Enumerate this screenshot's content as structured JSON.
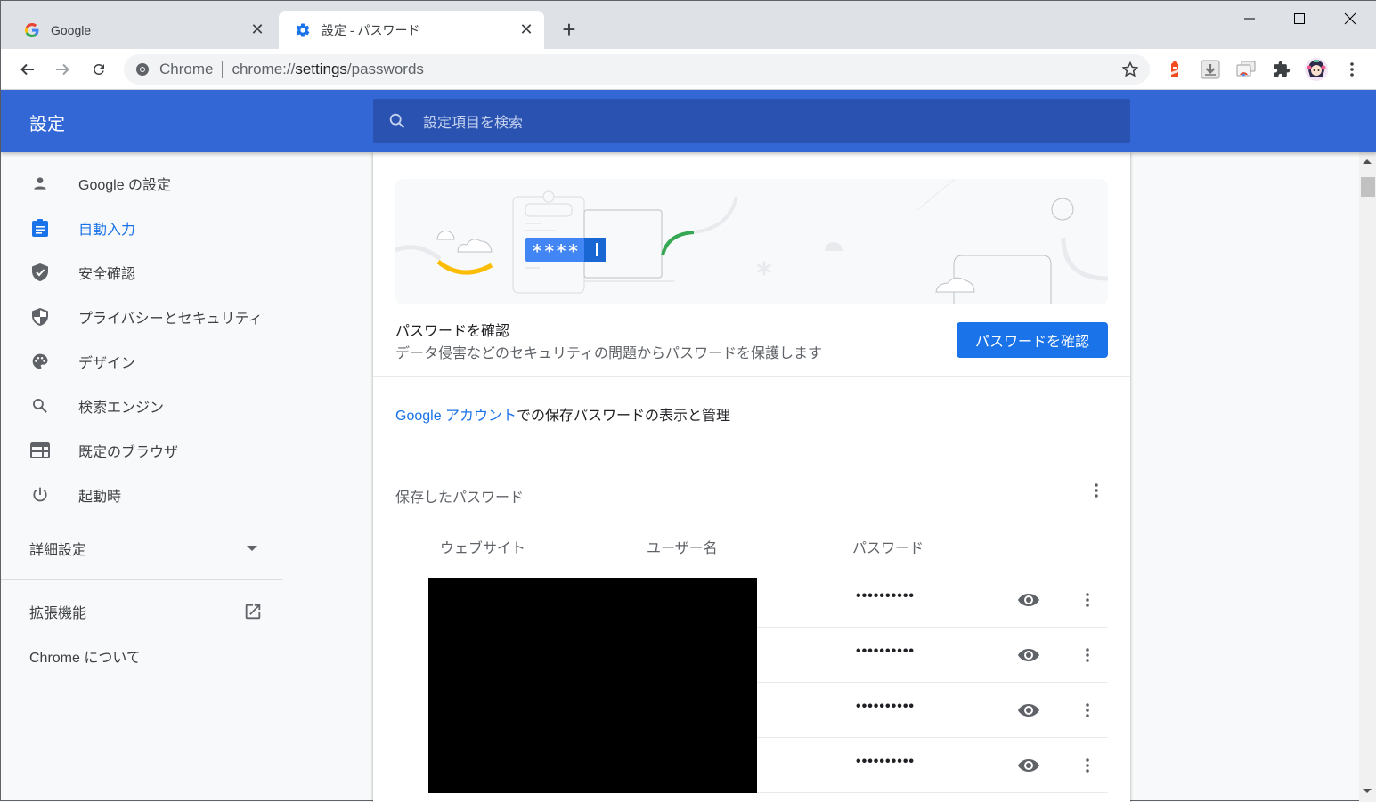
{
  "browser": {
    "tabs": [
      {
        "title": "Google",
        "favicon": "google-g-icon",
        "active": false
      },
      {
        "title": "設定 - パスワード",
        "favicon": "gear-icon",
        "active": true
      }
    ],
    "close_glyph": "✕",
    "new_tab_glyph": "+",
    "omnibox": {
      "chip": "Chrome",
      "url_prefix": "chrome://",
      "url_host": "settings",
      "url_path": "/passwords"
    },
    "extensions": [
      "lighthouse-icon",
      "download-icon",
      "cast-tab-icon",
      "puzzle-icon",
      "profile-avatar",
      "menu-kebab-icon"
    ]
  },
  "settings": {
    "header_title": "設定",
    "search_placeholder": "設定項目を検索",
    "sidebar": {
      "items": [
        {
          "label": "Google の設定",
          "icon": "person-icon",
          "selected": false
        },
        {
          "label": "自動入力",
          "icon": "clipboard-icon",
          "selected": true
        },
        {
          "label": "安全確認",
          "icon": "shield-check-icon",
          "selected": false
        },
        {
          "label": "プライバシーとセキュリティ",
          "icon": "shield-half-icon",
          "selected": false
        },
        {
          "label": "デザイン",
          "icon": "palette-icon",
          "selected": false
        },
        {
          "label": "検索エンジン",
          "icon": "search-icon",
          "selected": false
        },
        {
          "label": "既定のブラウザ",
          "icon": "browser-window-icon",
          "selected": false
        },
        {
          "label": "起動時",
          "icon": "power-icon",
          "selected": false
        }
      ],
      "advanced": "詳細設定",
      "extensions": "拡張機能",
      "about": "Chrome について"
    },
    "password_check": {
      "banner_text": "****",
      "title": "パスワードを確認",
      "subtitle": "データ侵害などのセキュリティの問題からパスワードを保護します",
      "button": "パスワードを確認"
    },
    "account_line": {
      "link": "Google アカウント",
      "rest": "での保存パスワードの表示と管理"
    },
    "saved_passwords": {
      "title": "保存したパスワード",
      "columns": [
        "ウェブサイト",
        "ユーザー名",
        "パスワード"
      ],
      "rows": [
        {
          "website": "",
          "username": "",
          "password": "••••••••••"
        },
        {
          "website": "",
          "username": "",
          "password": "••••••••••"
        },
        {
          "website": "",
          "username": "",
          "password": "••••••••••"
        },
        {
          "website": "",
          "username": "",
          "password": "••••••••••"
        }
      ]
    }
  }
}
